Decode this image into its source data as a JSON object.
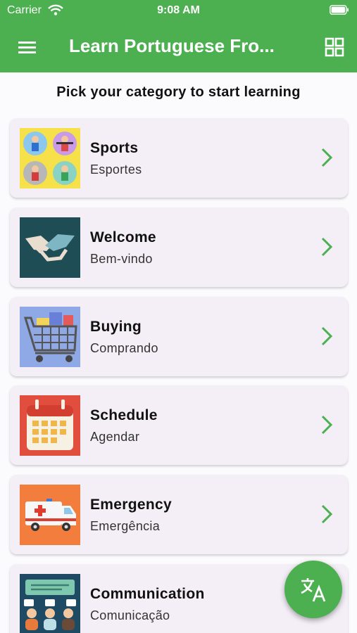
{
  "status_bar": {
    "carrier": "Carrier",
    "time": "9:08 AM"
  },
  "app_bar": {
    "title": "Learn Portuguese Fro...",
    "menu_icon": "hamburger-menu-icon",
    "grid_icon": "grid-view-icon"
  },
  "heading": "Pick your category to start learning",
  "categories": [
    {
      "name": "Sports",
      "translation": "Esportes",
      "icon": "sports-icon"
    },
    {
      "name": "Welcome",
      "translation": "Bem-vindo",
      "icon": "handshake-icon"
    },
    {
      "name": "Buying",
      "translation": "Comprando",
      "icon": "shopping-cart-icon"
    },
    {
      "name": "Schedule",
      "translation": "Agendar",
      "icon": "calendar-icon"
    },
    {
      "name": "Emergency",
      "translation": "Emergência",
      "icon": "ambulance-icon"
    },
    {
      "name": "Communication",
      "translation": "Comunicação",
      "icon": "communication-icon"
    }
  ],
  "fab": {
    "icon": "translate-icon"
  },
  "colors": {
    "primary": "#4caf50",
    "card": "#f4eff7",
    "chevron": "#4caf50"
  }
}
